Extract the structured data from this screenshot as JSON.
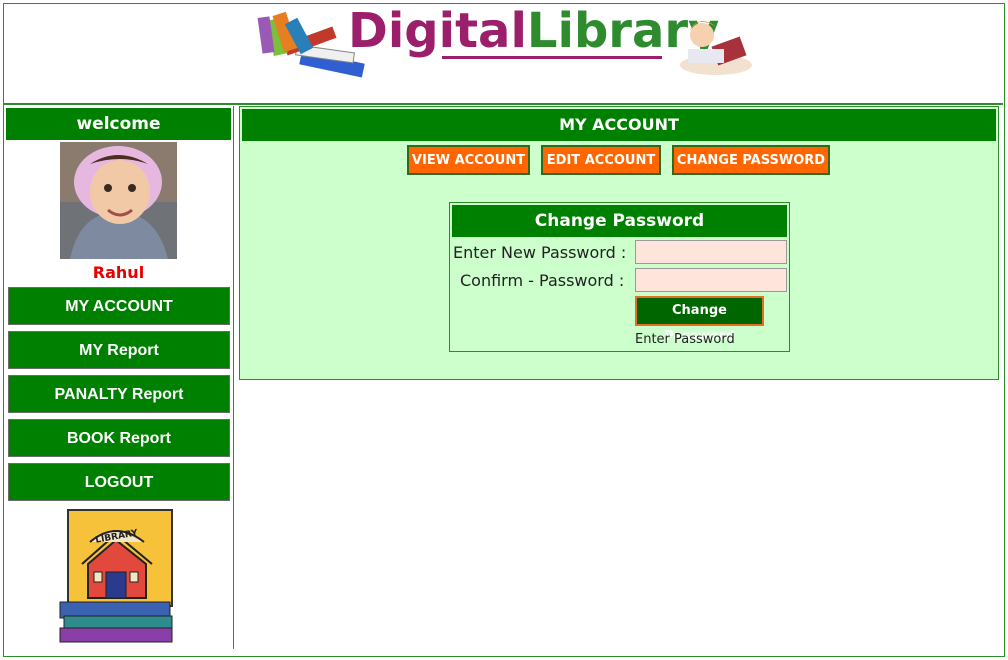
{
  "header": {
    "logo_word1": "Digital",
    "logo_word2": "Library"
  },
  "sidebar": {
    "welcome": "welcome",
    "username": "Rahul",
    "items": [
      {
        "label": "MY ACCOUNT"
      },
      {
        "label": "MY Report"
      },
      {
        "label": "PANALTY Report"
      },
      {
        "label": "BOOK Report"
      },
      {
        "label": "LOGOUT"
      }
    ],
    "library_sign": "LIBRARY"
  },
  "main": {
    "title": "MY ACCOUNT",
    "tabs": [
      {
        "label": "VIEW ACCOUNT"
      },
      {
        "label": "EDIT ACCOUNT"
      },
      {
        "label": "CHANGE PASSWORD"
      }
    ],
    "change_password": {
      "title": "Change Password",
      "new_label": "Enter New Password :",
      "confirm_label": "Confirm - Password :",
      "new_value": "",
      "confirm_value": "",
      "button": "Change Password",
      "hint": "Enter Password"
    }
  },
  "colors": {
    "brand_green": "#008000",
    "panel_bg": "#ccffcc",
    "tab_orange": "#ff6600",
    "input_bg": "#ffe4dc",
    "username_red": "#e60000",
    "logo_purple": "#9b1f6b"
  }
}
